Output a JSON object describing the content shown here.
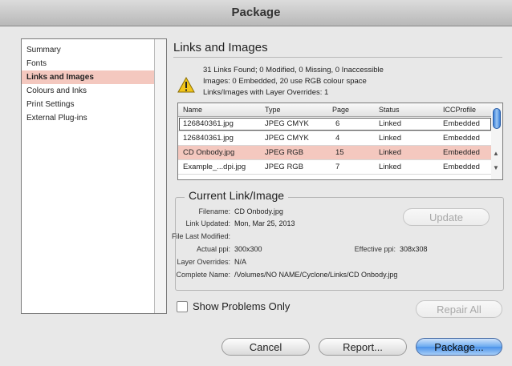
{
  "window": {
    "title": "Package"
  },
  "sidebar": {
    "items": [
      "Summary",
      "Fonts",
      "Links and Images",
      "Colours and Inks",
      "Print Settings",
      "External Plug-ins"
    ],
    "selected_index": 2
  },
  "main": {
    "heading": "Links and Images",
    "summary": [
      "31 Links Found; 0 Modified, 0 Missing, 0 Inaccessible",
      "Images: 0 Embedded, 20 use RGB colour space",
      "Links/Images with Layer Overrides: 1"
    ],
    "table": {
      "headers": [
        "Name",
        "Type",
        "Page",
        "Status",
        "ICCProfile"
      ],
      "rows": [
        [
          "126840361.jpg",
          "JPEG CMYK",
          "6",
          "Linked",
          "Embedded"
        ],
        [
          "126840361.jpg",
          "JPEG CMYK",
          "4",
          "Linked",
          "Embedded"
        ],
        [
          "CD Onbody.jpg",
          "JPEG RGB",
          "15",
          "Linked",
          "Embedded"
        ],
        [
          "Example_...dpi.jpg",
          "JPEG RGB",
          "7",
          "Linked",
          "Embedded"
        ]
      ],
      "selected_index": 2
    },
    "current": {
      "title": "Current Link/Image",
      "filename_label": "Filename:",
      "filename": "CD Onbody.jpg",
      "updated_label": "Link Updated:",
      "updated": "Mon, Mar 25, 2013",
      "modified_label": "File Last Modified:",
      "modified": "",
      "actual_ppi_label": "Actual ppi:",
      "actual_ppi": "300x300",
      "effective_ppi_label": "Effective ppi:",
      "effective_ppi": "308x308",
      "overrides_label": "Layer Overrides:",
      "overrides": "N/A",
      "complete_label": "Complete Name:",
      "complete": "/Volumes/NO NAME/Cyclone/Links/CD Onbody.jpg",
      "update_button": "Update"
    },
    "show_problems_label": "Show Problems Only",
    "repair_all_button": "Repair All"
  },
  "footer": {
    "cancel": "Cancel",
    "report": "Report...",
    "package": "Package..."
  }
}
